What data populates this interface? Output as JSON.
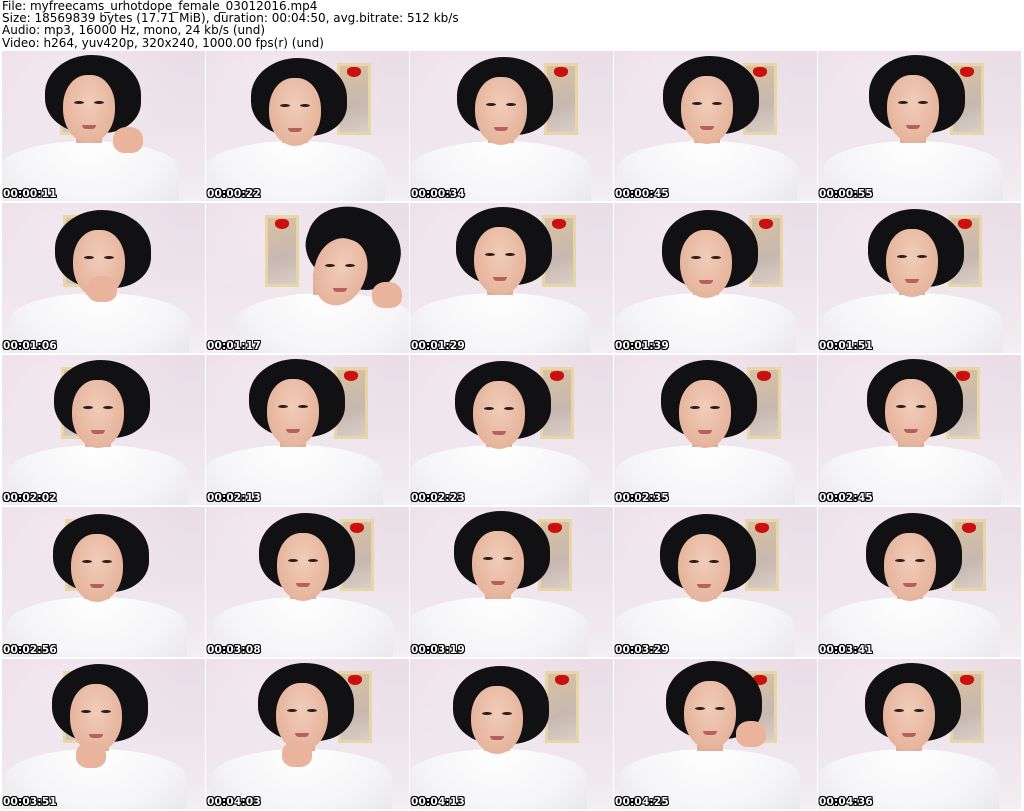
{
  "info": {
    "file_line": "File: myfreecams_urhotdope_female_03012016.mp4",
    "size_line": "Size: 18569839 bytes (17.71 MiB), duration: 00:04:50, avg.bitrate: 512 kb/s",
    "audio_line": "Audio: mp3, 16000 Hz, mono, 24 kb/s (und)",
    "video_line": "Video: h264, yuv420p, 320x240, 1000.00 fps(r) (und)"
  },
  "thumbnails": [
    {
      "timestamp": "00:00:11",
      "pose": "hand-hair"
    },
    {
      "timestamp": "00:00:22",
      "pose": "center"
    },
    {
      "timestamp": "00:00:34",
      "pose": "center"
    },
    {
      "timestamp": "00:00:45",
      "pose": "center"
    },
    {
      "timestamp": "00:00:55",
      "pose": "center"
    },
    {
      "timestamp": "00:01:06",
      "pose": "hand-mouth"
    },
    {
      "timestamp": "00:01:17",
      "pose": "lean-right"
    },
    {
      "timestamp": "00:01:29",
      "pose": "center"
    },
    {
      "timestamp": "00:01:39",
      "pose": "center"
    },
    {
      "timestamp": "00:01:51",
      "pose": "center"
    },
    {
      "timestamp": "00:02:02",
      "pose": "center"
    },
    {
      "timestamp": "00:02:13",
      "pose": "center"
    },
    {
      "timestamp": "00:02:23",
      "pose": "center"
    },
    {
      "timestamp": "00:02:35",
      "pose": "center"
    },
    {
      "timestamp": "00:02:45",
      "pose": "center"
    },
    {
      "timestamp": "00:02:56",
      "pose": "center"
    },
    {
      "timestamp": "00:03:08",
      "pose": "center"
    },
    {
      "timestamp": "00:03:19",
      "pose": "center"
    },
    {
      "timestamp": "00:03:29",
      "pose": "center"
    },
    {
      "timestamp": "00:03:41",
      "pose": "center"
    },
    {
      "timestamp": "00:03:51",
      "pose": "hand-chin"
    },
    {
      "timestamp": "00:04:03",
      "pose": "hand-chin"
    },
    {
      "timestamp": "00:04:13",
      "pose": "center"
    },
    {
      "timestamp": "00:04:25",
      "pose": "hand-hair-small"
    },
    {
      "timestamp": "00:04:36",
      "pose": "center"
    }
  ],
  "colors": {
    "timestamp_text": "#ffffff",
    "timestamp_outline": "#000000",
    "hair": "#111114",
    "sweater": "#f5f5f7",
    "bow": "#cc1010",
    "wall": "#ece3ea"
  }
}
